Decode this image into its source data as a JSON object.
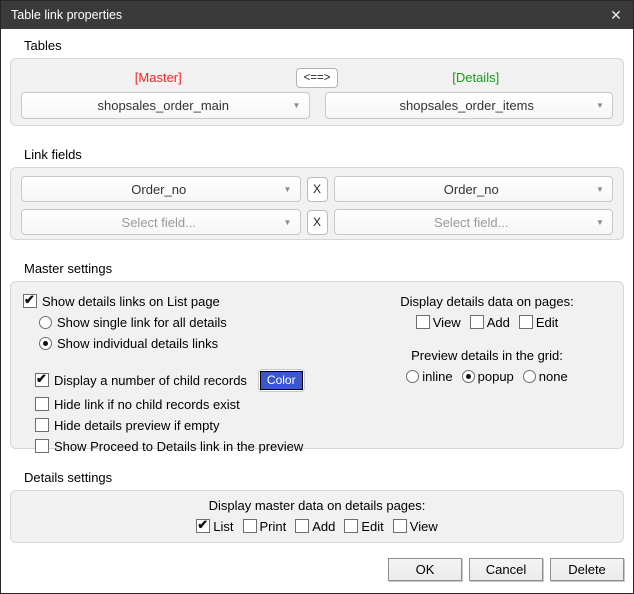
{
  "window": {
    "title": "Table link properties"
  },
  "tables": {
    "label": "Tables",
    "master_caption": "[Master]",
    "swap_label": "<==>",
    "details_caption": "[Details]",
    "master_table": "shopsales_order_main",
    "details_table": "shopsales_order_items"
  },
  "link_fields": {
    "label": "Link fields",
    "rows": [
      {
        "master_field": "Order_no",
        "remove_label": "X",
        "details_field": "Order_no",
        "is_placeholder": false
      },
      {
        "master_field": "Select field...",
        "remove_label": "X",
        "details_field": "Select field...",
        "is_placeholder": true
      }
    ]
  },
  "master_settings": {
    "label": "Master settings",
    "options": {
      "show_details_links": {
        "label": "Show details links on List page",
        "checked": true
      },
      "single_link": {
        "label": "Show single link for all details",
        "checked": false
      },
      "individual_links": {
        "label": "Show individual details links",
        "checked": true
      },
      "display_child_count": {
        "label": "Display a number of child records",
        "checked": true
      },
      "hide_link_no_children": {
        "label": "Hide link if no child records exist",
        "checked": false
      },
      "hide_preview_empty": {
        "label": "Hide details preview if empty",
        "checked": false
      },
      "show_proceed_link": {
        "label": "Show Proceed to Details link in the preview",
        "checked": false
      }
    },
    "color_button_label": "Color",
    "display_pages": {
      "label": "Display details data on pages:",
      "options": [
        {
          "label": "View",
          "checked": false
        },
        {
          "label": "Add",
          "checked": false
        },
        {
          "label": "Edit",
          "checked": false
        }
      ]
    },
    "preview_grid": {
      "label": "Preview details in the grid:",
      "options": [
        {
          "label": "inline",
          "checked": false
        },
        {
          "label": "popup",
          "checked": true
        },
        {
          "label": "none",
          "checked": false
        }
      ]
    }
  },
  "details_settings": {
    "label": "Details settings",
    "display_pages": {
      "label": "Display master data on details pages:",
      "options": [
        {
          "label": "List",
          "checked": true
        },
        {
          "label": "Print",
          "checked": false
        },
        {
          "label": "Add",
          "checked": false
        },
        {
          "label": "Edit",
          "checked": false
        },
        {
          "label": "View",
          "checked": false
        }
      ]
    }
  },
  "footer": {
    "ok_label": "OK",
    "cancel_label": "Cancel",
    "delete_label": "Delete"
  },
  "colors": {
    "titlebar": "#3a3a3a",
    "master_caption_red": "#f42525",
    "details_caption_green": "#1a9c1a",
    "color_button_blue": "#3a57d0"
  }
}
